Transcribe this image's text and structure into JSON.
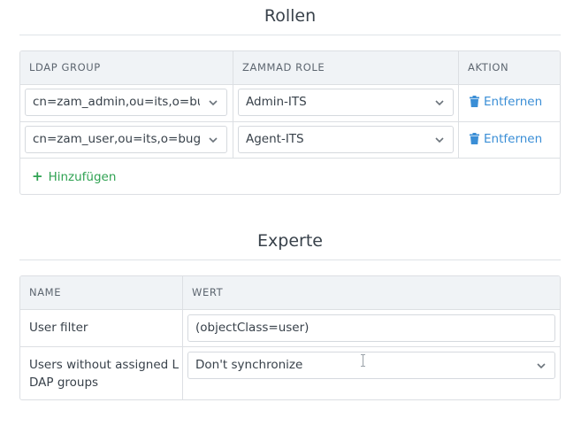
{
  "roles_section": {
    "title": "Rollen",
    "columns": {
      "ldap_group": "LDAP GROUP",
      "zammad_role": "ZAMMAD ROLE",
      "action": "AKTION"
    },
    "rows": [
      {
        "ldap_group": "cn=zam_admin,ou=its,o=bug",
        "zammad_role": "Admin-ITS",
        "remove_label": "Entfernen"
      },
      {
        "ldap_group": "cn=zam_user,ou=its,o=bug",
        "zammad_role": "Agent-ITS",
        "remove_label": "Entfernen"
      }
    ],
    "add_label": "Hinzufügen"
  },
  "expert_section": {
    "title": "Experte",
    "columns": {
      "name": "NAME",
      "value": "WERT"
    },
    "rows": [
      {
        "name": "User filter",
        "value": "(objectClass=user)"
      },
      {
        "name_line1": "Users without assigned L",
        "name_line2": "DAP groups",
        "value": "Don't synchronize"
      }
    ]
  },
  "colors": {
    "link": "#3a8ed6",
    "add": "#2fa252",
    "header_bg": "#f0f3f6",
    "border": "#dcdfe3"
  },
  "icons": {
    "remove": "trash-icon",
    "dropdown": "chevron-down-icon",
    "add": "plus-icon"
  }
}
